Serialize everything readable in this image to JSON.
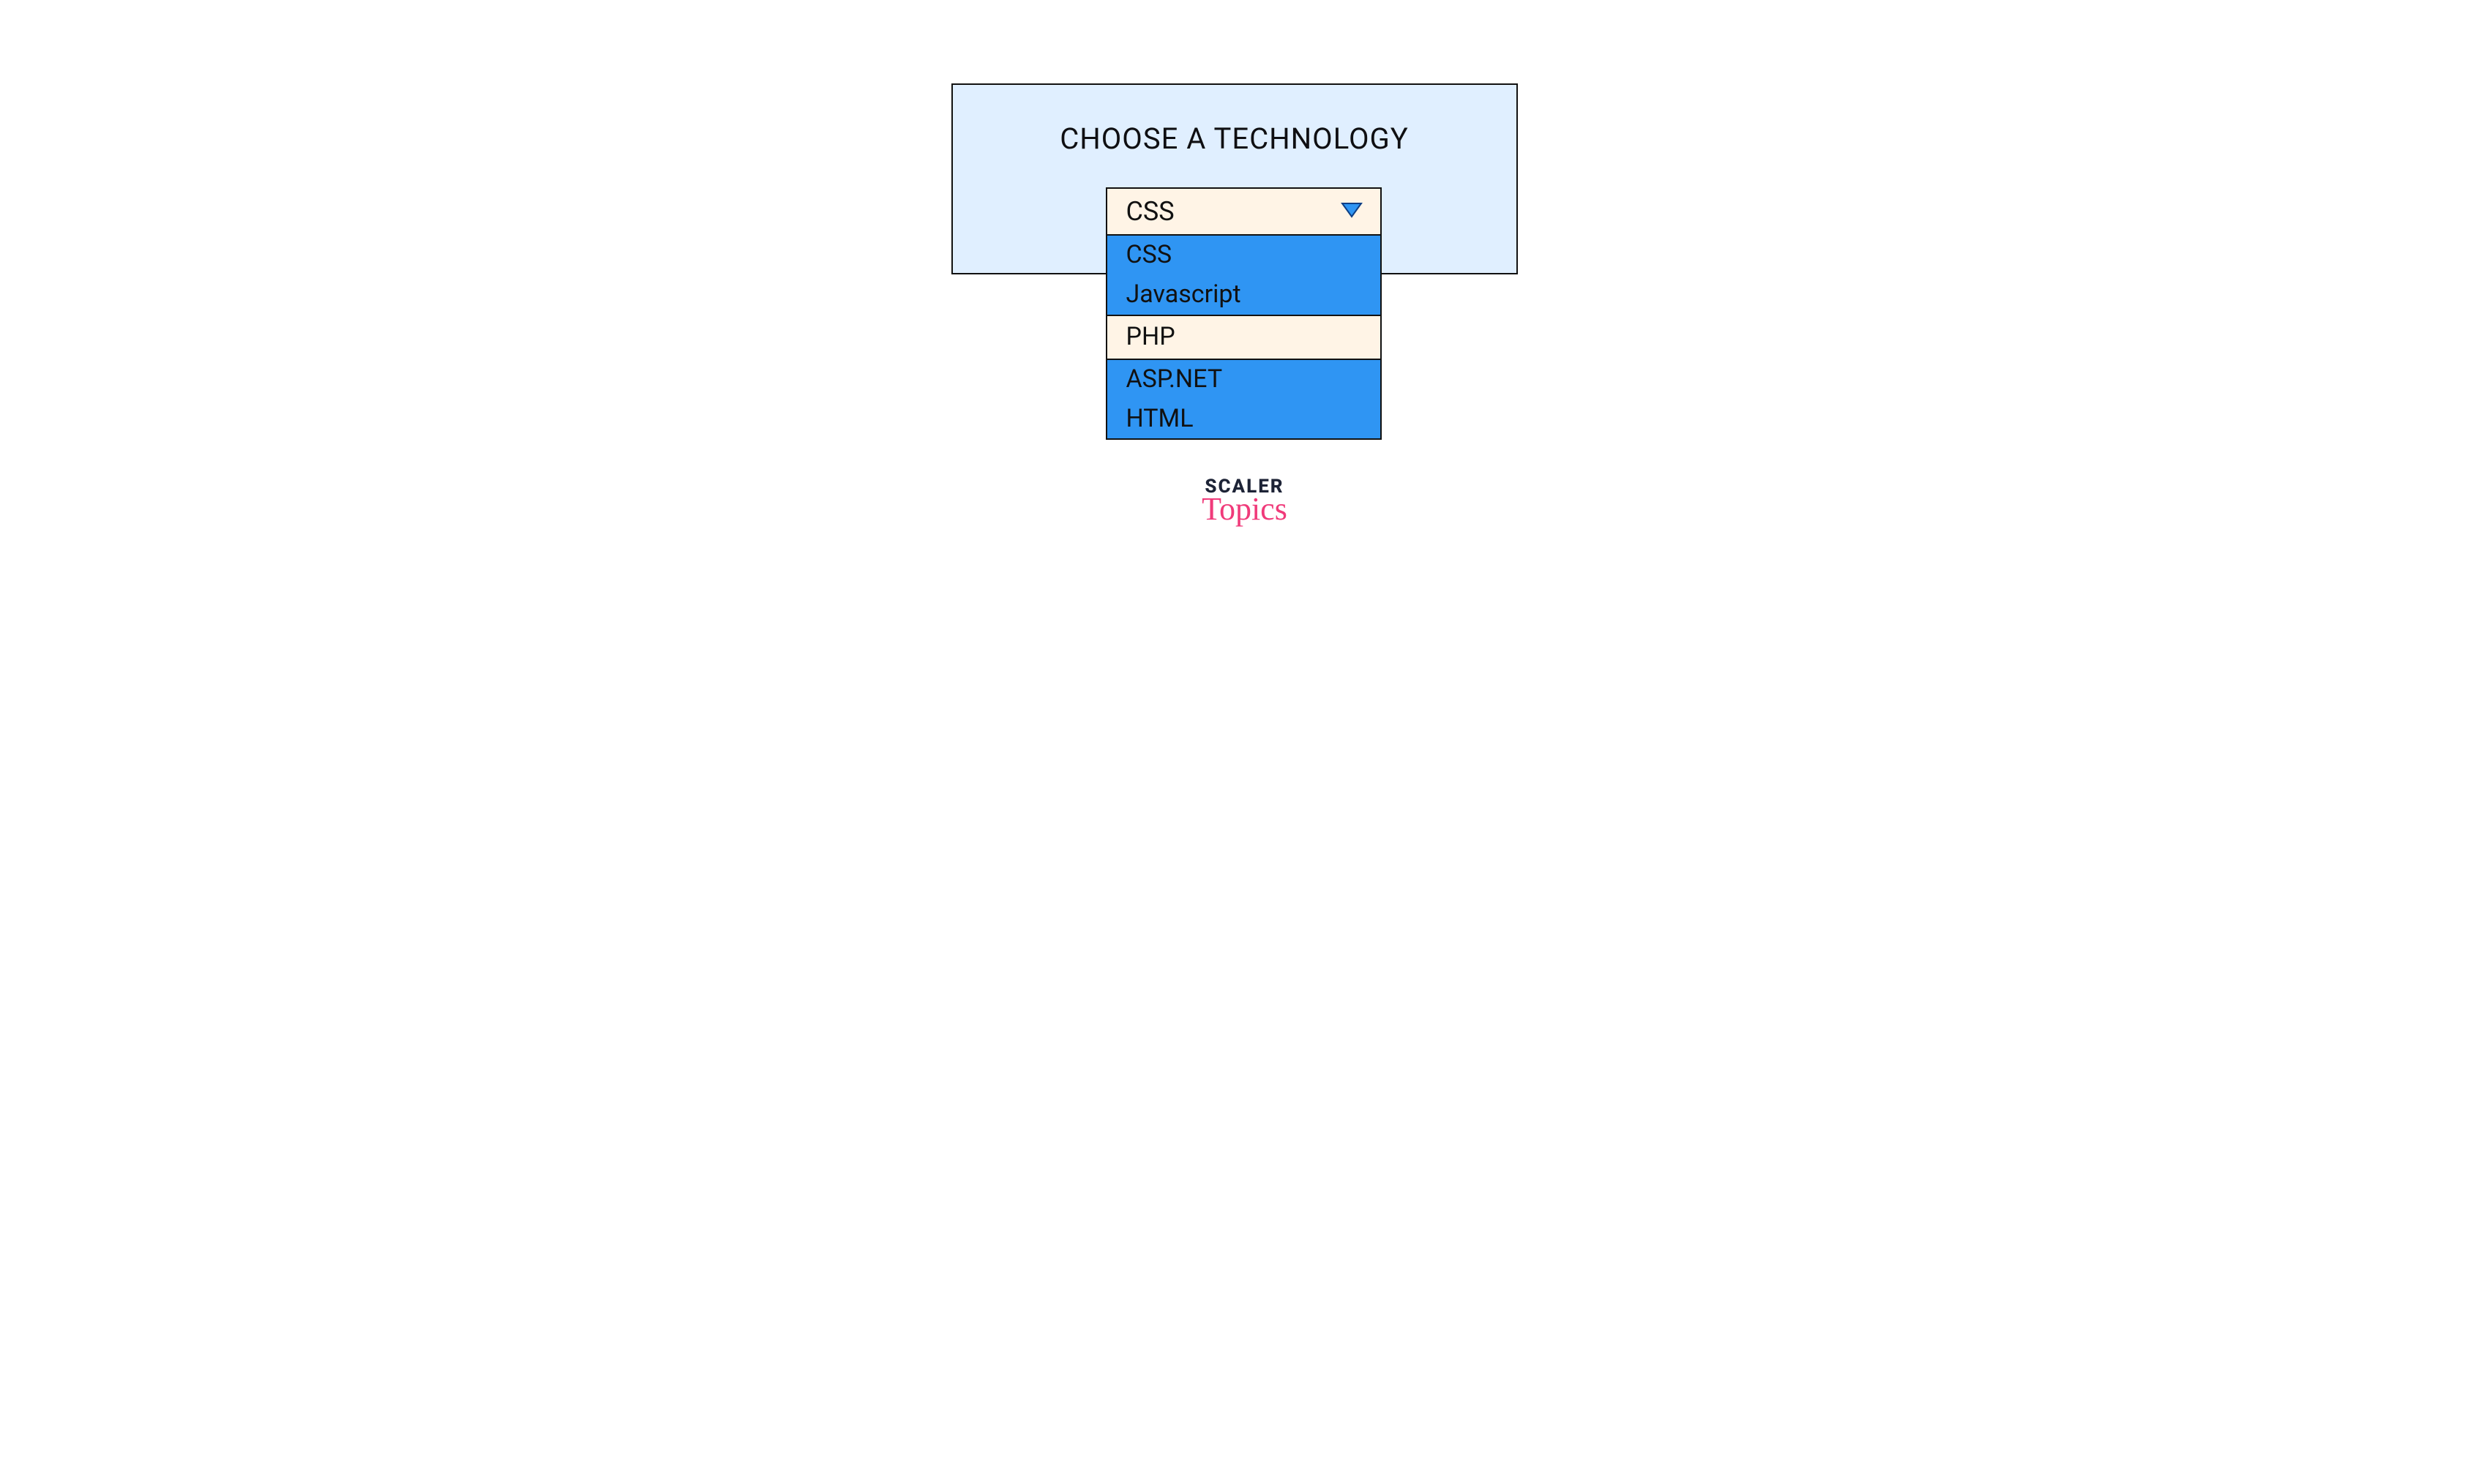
{
  "panel": {
    "title": "CHOOSE A TECHNOLOGY"
  },
  "dropdown": {
    "selected": "CSS",
    "options": [
      {
        "label": "CSS",
        "highlight": false
      },
      {
        "label": "Javascript",
        "highlight": false
      },
      {
        "label": "PHP",
        "highlight": true
      },
      {
        "label": "ASP.NET",
        "highlight": false
      },
      {
        "label": "HTML",
        "highlight": false
      }
    ]
  },
  "brand": {
    "line1": "SCALER",
    "line2": "Topics"
  },
  "colors": {
    "panel_bg": "#e0efff",
    "option_bg": "#2f95f3",
    "highlight_bg": "#fff4e6",
    "border": "#111111",
    "brand_pink": "#f03a7a",
    "brand_navy": "#1d2336"
  }
}
